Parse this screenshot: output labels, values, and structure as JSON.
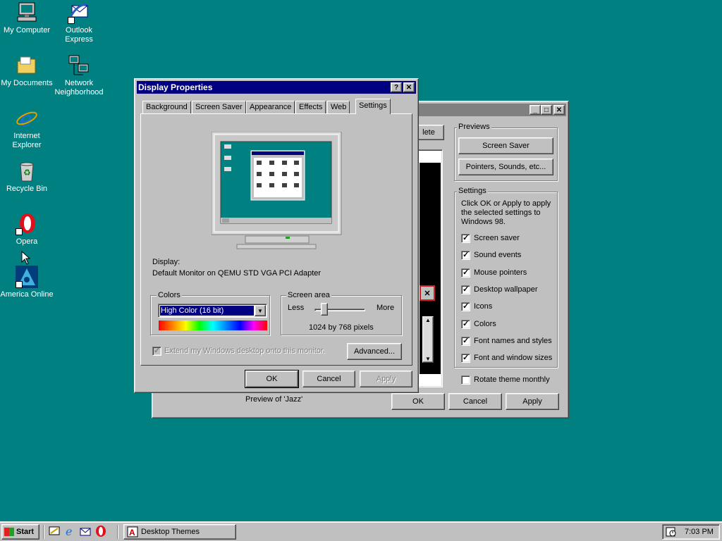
{
  "desktop": {
    "icons": [
      {
        "label1": "My Computer",
        "label2": ""
      },
      {
        "label1": "Outlook",
        "label2": "Express"
      },
      {
        "label1": "My Documents",
        "label2": ""
      },
      {
        "label1": "Network",
        "label2": "Neighborhood"
      },
      {
        "label1": "Internet",
        "label2": "Explorer"
      },
      {
        "label1": "Recycle Bin",
        "label2": ""
      },
      {
        "label1": "Opera",
        "label2": ""
      },
      {
        "label1": "America Online",
        "label2": ""
      }
    ]
  },
  "themes_window": {
    "delete_fragment": "lete",
    "previews_group": "Previews",
    "screen_saver_btn": "Screen Saver",
    "pointers_btn": "Pointers, Sounds, etc...",
    "settings_group": "Settings",
    "settings_text": "Click OK or Apply to apply the selected settings to Windows 98.",
    "checks": [
      {
        "label": "Screen saver",
        "checked": true
      },
      {
        "label": "Sound events",
        "checked": true
      },
      {
        "label": "Mouse pointers",
        "checked": true
      },
      {
        "label": "Desktop wallpaper",
        "checked": true
      },
      {
        "label": "Icons",
        "checked": true
      },
      {
        "label": "Colors",
        "checked": true
      },
      {
        "label": "Font names and styles",
        "checked": true
      },
      {
        "label": "Font and window sizes",
        "checked": true
      }
    ],
    "rotate": {
      "label": "Rotate theme monthly",
      "checked": false
    },
    "preview_caption": "Preview of 'Jazz'",
    "ok": "OK",
    "cancel": "Cancel",
    "apply": "Apply"
  },
  "display_props": {
    "title": "Display Properties",
    "tabs": [
      "Background",
      "Screen Saver",
      "Appearance",
      "Effects",
      "Web",
      "Settings"
    ],
    "active_tab": "Settings",
    "display_label": "Display:",
    "display_value": "Default Monitor on QEMU STD VGA PCI Adapter",
    "colors_group": "Colors",
    "colors_value": "High Color (16 bit)",
    "screen_area_group": "Screen area",
    "less": "Less",
    "more": "More",
    "resolution": "1024 by 768 pixels",
    "extend_label": "Extend my Windows desktop onto this monitor.",
    "advanced_btn": "Advanced...",
    "ok": "OK",
    "cancel": "Cancel",
    "apply": "Apply",
    "help_glyph": "?",
    "close_glyph": "✕"
  },
  "taskbar": {
    "start": "Start",
    "task": "Desktop Themes",
    "clock": "7:03 PM"
  },
  "colors": {
    "desktop": "#008080",
    "title_active": "#000080",
    "title_inactive": "#808080",
    "face": "#c0c0c0"
  }
}
